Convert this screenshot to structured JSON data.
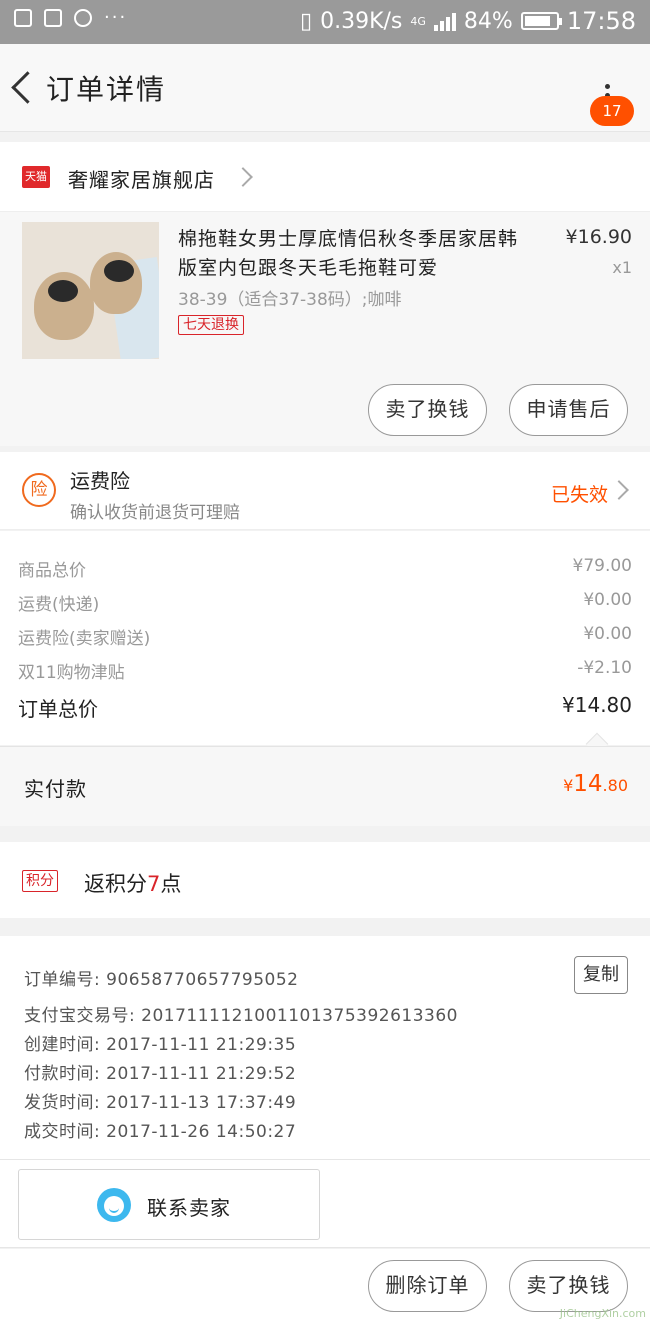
{
  "status_bar": {
    "network_speed": "0.39K/s",
    "network_type": "4G",
    "battery": "84%",
    "battery_level": 0.84,
    "time": "17:58",
    "more": "···"
  },
  "header": {
    "title": "订单详情",
    "badge_count": "17"
  },
  "shop": {
    "tag": "天猫",
    "name": "奢耀家居旗舰店"
  },
  "product": {
    "title": "棉拖鞋女男士厚底情侣秋冬季居家居韩版室内包跟冬天毛毛拖鞋可爱",
    "sku": "38-39（适合37-38码）;咖啡",
    "tag": "七天退换",
    "price": "¥16.90",
    "qty": "x1",
    "sell_button": "卖了换钱",
    "aftersale_button": "申请售后"
  },
  "insurance": {
    "icon_text": "险",
    "title": "运费险",
    "subtitle": "确认收货前退货可理赔",
    "status": "已失效"
  },
  "fees": [
    {
      "label": "商品总价",
      "value": "¥79.00"
    },
    {
      "label": "运费(快递)",
      "value": "¥0.00"
    },
    {
      "label": "运费险(卖家赠送)",
      "value": "¥0.00"
    },
    {
      "label": "双11购物津贴",
      "value": "-¥2.10"
    }
  ],
  "order_total": {
    "label": "订单总价",
    "value": "¥14.80"
  },
  "paid": {
    "label": "实付款",
    "currency": "¥",
    "integer": "14",
    "decimal": ".80"
  },
  "points": {
    "tag": "积分",
    "text_prefix": "返积分",
    "count": "7",
    "text_suffix": "点"
  },
  "order_info": {
    "copy_button": "复制",
    "rows": [
      "订单编号: 90658770657795052",
      "支付宝交易号: 2017111121001101375392613360",
      "创建时间: 2017-11-11 21:29:35",
      "付款时间: 2017-11-11 21:29:52",
      "发货时间: 2017-11-13 17:37:49",
      "成交时间: 2017-11-26 14:50:27"
    ]
  },
  "contact": {
    "label": "联系卖家"
  },
  "bottom_bar": {
    "delete_button": "删除订单",
    "sell_button": "卖了换钱"
  },
  "watermark": "JiChengXin.com",
  "colors": {
    "accent": "#ff5000",
    "tmall_red": "#e0292b",
    "contact_blue": "#3db8ee"
  }
}
